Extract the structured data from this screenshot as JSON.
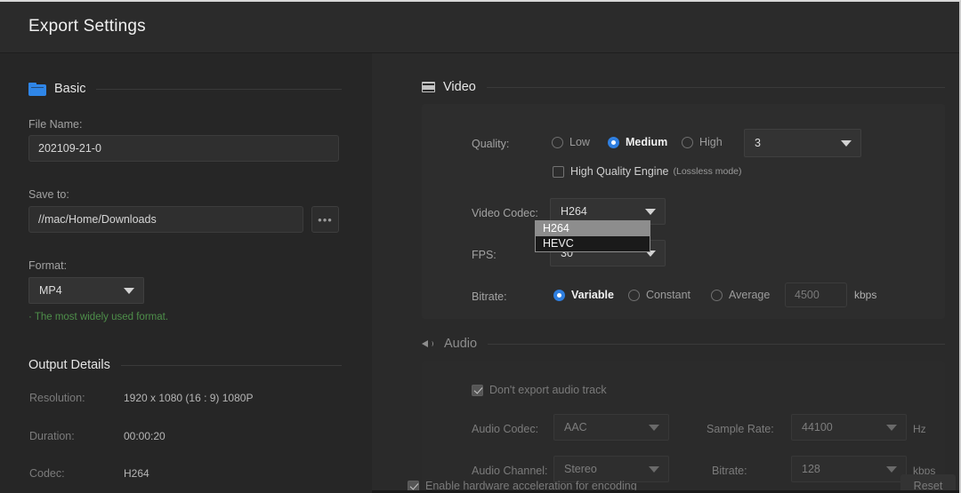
{
  "window": {
    "title": "Export Settings"
  },
  "basic": {
    "section_label": "Basic",
    "section_icon": "folder-icon",
    "file_name_label": "File Name:",
    "file_name_value": "202109-21-0",
    "save_to_label": "Save to:",
    "save_to_value": "//mac/Home/Downloads",
    "browse_label": "•••",
    "format_label": "Format:",
    "format_value": "MP4",
    "format_hint": "· The most widely used format."
  },
  "output_details": {
    "section_label": "Output Details",
    "rows": [
      {
        "label": "Resolution:",
        "value": "1920 x 1080   (16 : 9)   1080P"
      },
      {
        "label": "Duration:",
        "value": "00:00:20"
      },
      {
        "label": "Codec:",
        "value": "H264"
      }
    ]
  },
  "video": {
    "section_label": "Video",
    "section_icon": "film-icon",
    "quality_label": "Quality:",
    "quality_options": [
      {
        "label": "Low",
        "selected": false
      },
      {
        "label": "Medium",
        "selected": true
      },
      {
        "label": "High",
        "selected": false
      }
    ],
    "quality_level_value": "3",
    "hq_engine_label": "High Quality Engine",
    "hq_engine_sub": "(Lossless mode)",
    "hq_engine_checked": false,
    "codec_label": "Video Codec:",
    "codec_value": "H264",
    "codec_options": [
      {
        "label": "H264",
        "highlighted": true
      },
      {
        "label": "HEVC",
        "highlighted": false
      }
    ],
    "fps_label": "FPS:",
    "fps_value": "30",
    "bitrate_label": "Bitrate:",
    "bitrate_options": [
      {
        "label": "Variable",
        "selected": true
      },
      {
        "label": "Constant",
        "selected": false
      },
      {
        "label": "Average",
        "selected": false
      }
    ],
    "bitrate_value": "4500",
    "bitrate_unit": "kbps"
  },
  "audio": {
    "section_label": "Audio",
    "section_icon": "speaker-icon",
    "dont_export_label": "Don't export audio track",
    "dont_export_checked": true,
    "codec_label": "Audio Codec:",
    "codec_value": "AAC",
    "sample_rate_label": "Sample Rate:",
    "sample_rate_value": "44100",
    "sample_rate_unit": "Hz",
    "channel_label": "Audio Channel:",
    "channel_value": "Stereo",
    "bitrate_label": "Bitrate:",
    "bitrate_value": "128",
    "bitrate_unit": "kbps"
  },
  "footer": {
    "hw_accel_label": "Enable hardware acceleration for encoding",
    "hw_accel_checked": true,
    "reset_label": "Reset"
  },
  "colors": {
    "accent_blue": "#2f7fe0",
    "folder_blue": "#2f86e8",
    "hint_green": "#4e8f4a",
    "window_bg": "#262626",
    "panel_bg": "#2a2a2a",
    "card_bg": "#2d2d2d"
  }
}
